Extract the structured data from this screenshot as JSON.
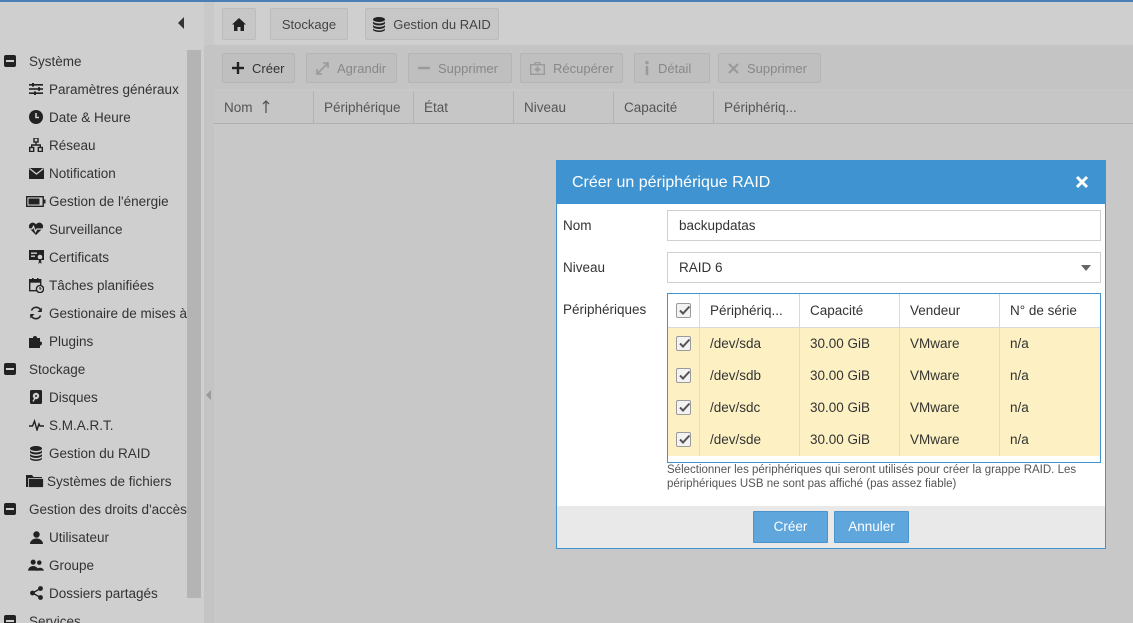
{
  "header": {
    "breadcrumbs": [
      "Stockage",
      "Gestion du RAID"
    ]
  },
  "sidebar": {
    "groups": [
      {
        "label": "Système",
        "items": [
          {
            "label": "Paramètres généraux",
            "icon": "sliders-icon"
          },
          {
            "label": "Date & Heure",
            "icon": "clock-icon"
          },
          {
            "label": "Réseau",
            "icon": "network-icon"
          },
          {
            "label": "Notification",
            "icon": "envelope-icon"
          },
          {
            "label": "Gestion de l'énergie",
            "icon": "battery-icon"
          },
          {
            "label": "Surveillance",
            "icon": "heartbeat-icon"
          },
          {
            "label": "Certificats",
            "icon": "certificate-icon"
          },
          {
            "label": "Tâches planifiées",
            "icon": "calendar-clock-icon"
          },
          {
            "label": "Gestionaire de mises à",
            "icon": "refresh-icon"
          },
          {
            "label": "Plugins",
            "icon": "puzzle-icon"
          }
        ]
      },
      {
        "label": "Stockage",
        "items": [
          {
            "label": "Disques",
            "icon": "disk-icon"
          },
          {
            "label": "S.M.A.R.T.",
            "icon": "pulse-icon"
          },
          {
            "label": "Gestion du RAID",
            "icon": "database-icon"
          },
          {
            "label": "Systèmes de fichiers",
            "icon": "folder-icon"
          }
        ]
      },
      {
        "label": "Gestion des droits d'accès",
        "items": [
          {
            "label": "Utilisateur",
            "icon": "user-icon"
          },
          {
            "label": "Groupe",
            "icon": "group-icon"
          },
          {
            "label": "Dossiers partagés",
            "icon": "share-icon"
          }
        ]
      },
      {
        "label": "Services",
        "items": []
      }
    ]
  },
  "toolbar": {
    "create": "Créer",
    "grow": "Agrandir",
    "remove": "Supprimer",
    "recover": "Récupérer",
    "detail": "Détail",
    "delete": "Supprimer"
  },
  "grid": {
    "columns": [
      "Nom",
      "Périphérique",
      "État",
      "Niveau",
      "Capacité",
      "Périphériq..."
    ]
  },
  "modal": {
    "title": "Créer un périphérique RAID",
    "name_label": "Nom",
    "name_value": "backupdatas",
    "level_label": "Niveau",
    "level_value": "RAID 6",
    "devices_label": "Périphériques",
    "table_columns": [
      "Périphériq...",
      "Capacité",
      "Vendeur",
      "N° de série"
    ],
    "devices": [
      {
        "device": "/dev/sda",
        "capacity": "30.00 GiB",
        "vendor": "VMware",
        "serial": "n/a",
        "checked": true
      },
      {
        "device": "/dev/sdb",
        "capacity": "30.00 GiB",
        "vendor": "VMware",
        "serial": "n/a",
        "checked": true
      },
      {
        "device": "/dev/sdc",
        "capacity": "30.00 GiB",
        "vendor": "VMware",
        "serial": "n/a",
        "checked": true
      },
      {
        "device": "/dev/sde",
        "capacity": "30.00 GiB",
        "vendor": "VMware",
        "serial": "n/a",
        "checked": true
      }
    ],
    "hint": "Sélectionner les périphériques qui seront utilisés pour créer la grappe RAID. Les périphériques USB ne sont pas affiché (pas assez fiable)",
    "create_button": "Créer",
    "cancel_button": "Annuler"
  },
  "colors": {
    "accent": "#3e93d0",
    "button": "#5ea6dc",
    "row_selected": "#fdf1c4"
  }
}
